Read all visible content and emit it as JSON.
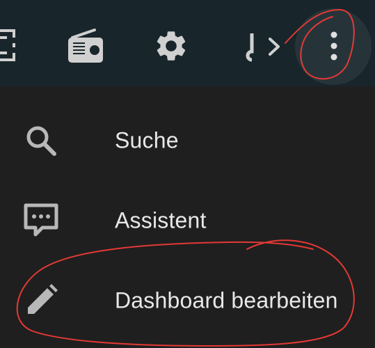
{
  "toolbar": {
    "icons": [
      "screen-frame-icon",
      "radio-icon",
      "gear-icon",
      "code-chevron-icon",
      "more-vert-icon"
    ]
  },
  "menu": {
    "items": [
      {
        "label": "Suche",
        "icon": "search-icon"
      },
      {
        "label": "Assistent",
        "icon": "assistant-chat-icon"
      },
      {
        "label": "Dashboard bearbeiten",
        "icon": "pencil-icon"
      }
    ]
  },
  "colors": {
    "toolbar_bg": "#18252b",
    "menu_bg": "#1f1f1f",
    "icon": "#c8c8c8",
    "text": "#e8e8e8",
    "annotation": "#e53935"
  }
}
